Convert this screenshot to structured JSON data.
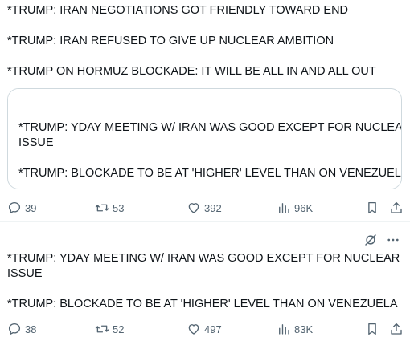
{
  "tweet1": {
    "lines": [
      "*TRUMP: IRAN NEGOTIATIONS GOT FRIENDLY TOWARD END",
      "*TRUMP: IRAN REFUSED TO GIVE UP NUCLEAR AMBITION",
      "*TRUMP ON HORMUZ BLOCKADE: IT WILL BE ALL IN AND ALL OUT"
    ],
    "quote": {
      "line1": "*TRUMP: YDAY MEETING W/ IRAN WAS GOOD EXCEPT FOR NUCLEAR",
      "line2": "ISSUE",
      "line3": "*TRUMP: BLOCKADE TO BE AT 'HIGHER' LEVEL THAN ON VENEZUELA"
    },
    "actions": {
      "replies": "39",
      "reposts": "53",
      "likes": "392",
      "views": "96K"
    }
  },
  "tweet2": {
    "line1": "*TRUMP: YDAY MEETING W/ IRAN WAS GOOD EXCEPT FOR NUCLEAR",
    "line2": "ISSUE",
    "line3": "*TRUMP: BLOCKADE TO BE AT 'HIGHER' LEVEL THAN ON VENEZUELA",
    "actions": {
      "replies": "38",
      "reposts": "52",
      "likes": "497",
      "views": "83K"
    }
  },
  "icons": {
    "reply": "reply-icon",
    "repost": "repost-icon",
    "like": "heart-icon",
    "views": "analytics-icon",
    "bookmark": "bookmark-icon",
    "share": "share-icon",
    "grok": "grok-icon",
    "more": "more-icon"
  },
  "colors": {
    "text": "#0f1419",
    "secondary": "#536471",
    "border": "#cfd9de"
  }
}
